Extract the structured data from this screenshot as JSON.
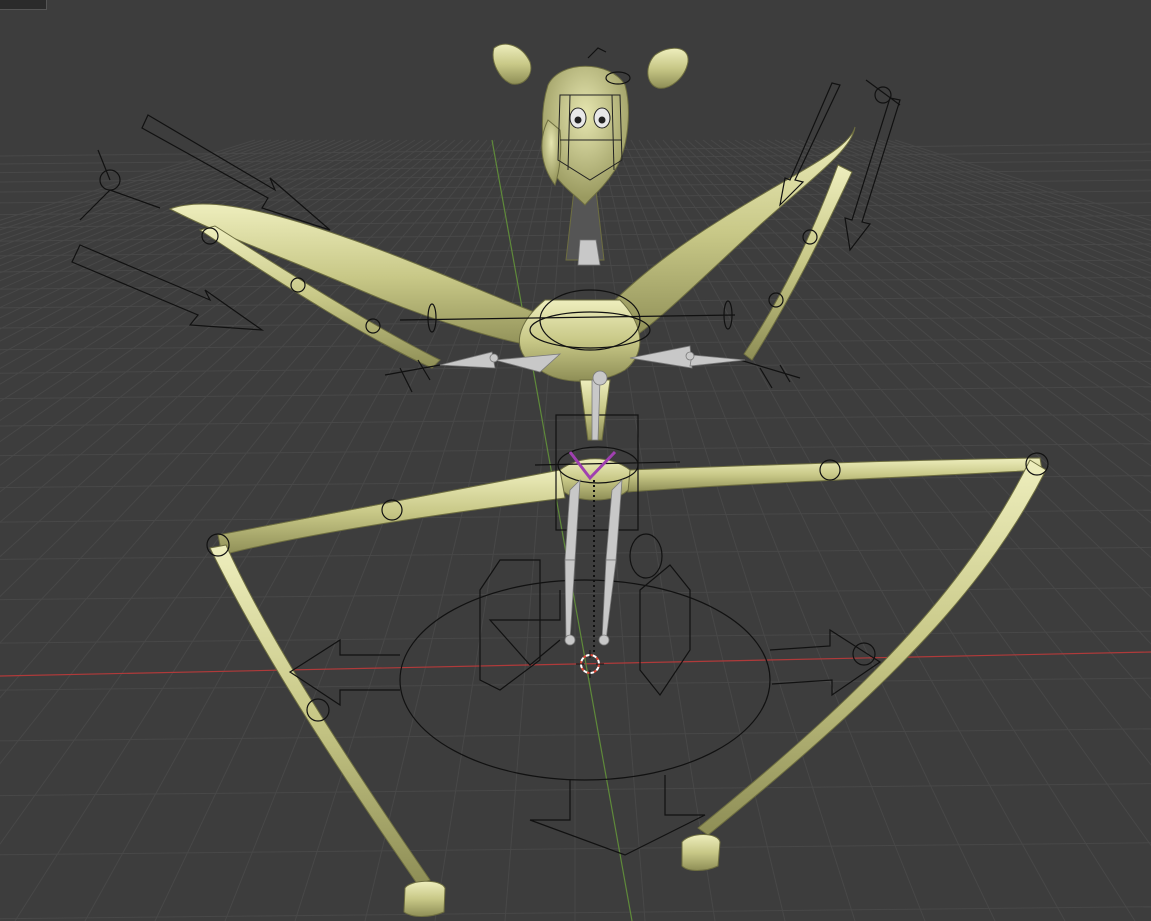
{
  "viewport": {
    "background": "#3d3d3d",
    "grid_color": "#484848",
    "axis_x_color": "#b03a3a",
    "axis_y_color": "#5f8a3a"
  },
  "mesh": {
    "color": "#cfcf8c",
    "shade_color": "#8f8f57",
    "highlight_color": "#f2f2d0"
  },
  "armature": {
    "line_color": "#111111",
    "bone_color": "#c8c8c8",
    "selected_bone_color": "#a040b0"
  },
  "cursor_3d": {
    "ring_color": "#e04a3a"
  },
  "icons": [
    "3d-cursor-icon",
    "axis-gizmo-icon"
  ]
}
